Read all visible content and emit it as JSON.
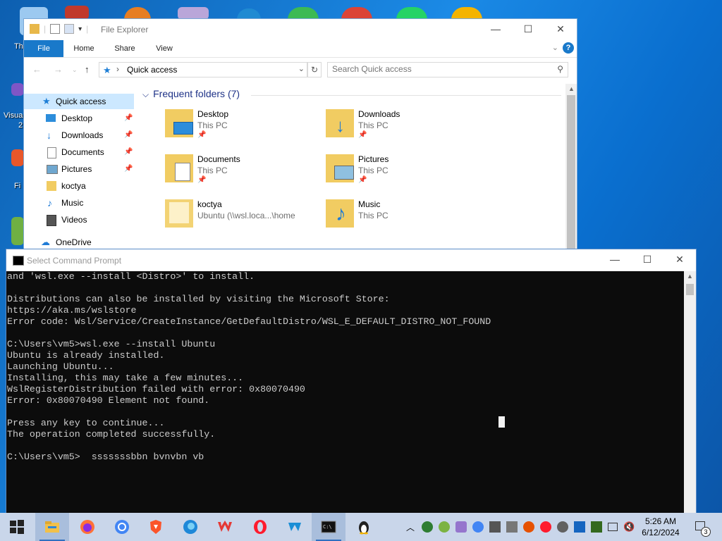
{
  "desktop": {
    "labels": [
      "Th",
      "Visua",
      "2",
      "Fi"
    ]
  },
  "file_explorer": {
    "title": "File Explorer",
    "tabs": [
      "File",
      "Home",
      "Share",
      "View"
    ],
    "help_label": "?",
    "address": "Quick access",
    "search_placeholder": "Search Quick access",
    "nav_items": [
      {
        "label": "Quick access",
        "icon": "star-icon"
      },
      {
        "label": "Desktop",
        "icon": "desktop-icon"
      },
      {
        "label": "Downloads",
        "icon": "download-icon"
      },
      {
        "label": "Documents",
        "icon": "documents-icon"
      },
      {
        "label": "Pictures",
        "icon": "pictures-icon"
      },
      {
        "label": "koctya",
        "icon": "folder-icon"
      },
      {
        "label": "Music",
        "icon": "music-icon"
      },
      {
        "label": "Videos",
        "icon": "videos-icon"
      },
      {
        "label": "OneDrive",
        "icon": "cloud-icon"
      }
    ],
    "group_title": "Frequent folders (7)",
    "folders": [
      {
        "name": "Desktop",
        "location": "This PC",
        "pinned": true
      },
      {
        "name": "Downloads",
        "location": "This PC",
        "pinned": true
      },
      {
        "name": "Documents",
        "location": "This PC",
        "pinned": true
      },
      {
        "name": "Pictures",
        "location": "This PC",
        "pinned": true
      },
      {
        "name": "koctya",
        "location": "Ubuntu (\\\\wsl.loca...\\home",
        "pinned": false
      },
      {
        "name": "Music",
        "location": "This PC",
        "pinned": false
      }
    ]
  },
  "cmd": {
    "title": "Select Command Prompt",
    "lines": [
      "and 'wsl.exe --install <Distro>' to install.",
      "",
      "Distributions can also be installed by visiting the Microsoft Store:",
      "https://aka.ms/wslstore",
      "Error code: Wsl/Service/CreateInstance/GetDefaultDistro/WSL_E_DEFAULT_DISTRO_NOT_FOUND",
      "",
      "C:\\Users\\vm5>wsl.exe --install Ubuntu",
      "Ubuntu is already installed.",
      "Launching Ubuntu...",
      "Installing, this may take a few minutes...",
      "WslRegisterDistribution failed with error: 0x80070490",
      "Error: 0x80070490 Element not found.",
      "",
      "Press any key to continue...",
      "The operation completed successfully.",
      "",
      "C:\\Users\\vm5>  sssssssbbn bvnvbn vb"
    ]
  },
  "taskbar": {
    "apps": [
      "start-icon",
      "file-explorer-icon",
      "firefox-icon",
      "chrome-icon",
      "brave-icon",
      "edge-icon",
      "wps-icon",
      "opera-icon",
      "winget-icon",
      "cmd-icon",
      "linux-icon"
    ],
    "time": "5:26 AM",
    "date": "6/12/2024",
    "notification_count": "3"
  }
}
